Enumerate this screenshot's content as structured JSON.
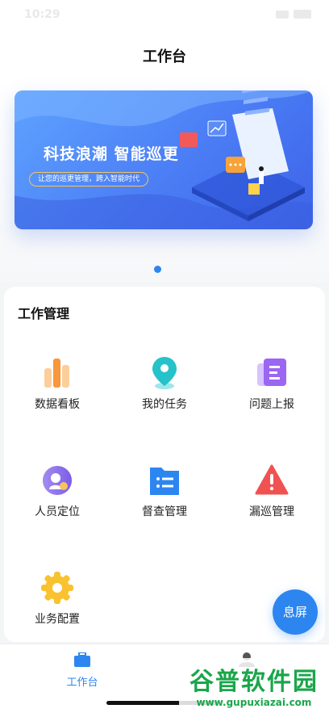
{
  "status_bar": {
    "time": "10:29"
  },
  "header": {
    "title": "工作台"
  },
  "banner": {
    "title": "科技浪潮 智能巡更",
    "subtitle": "让您的巡更管理，跨入智能时代"
  },
  "card": {
    "title": "工作管理",
    "items": [
      {
        "label": "数据看板",
        "icon": "bar-chart-icon"
      },
      {
        "label": "我的任务",
        "icon": "location-pin-icon"
      },
      {
        "label": "问题上报",
        "icon": "report-document-icon"
      },
      {
        "label": "人员定位",
        "icon": "person-location-icon"
      },
      {
        "label": "督查管理",
        "icon": "folder-list-icon"
      },
      {
        "label": "漏巡管理",
        "icon": "warning-triangle-icon"
      },
      {
        "label": "业务配置",
        "icon": "gear-icon"
      }
    ]
  },
  "float_button": {
    "label": "息屏"
  },
  "tabbar": {
    "tabs": [
      {
        "label": "工作台",
        "active": true
      },
      {
        "label": "",
        "active": false
      }
    ]
  },
  "watermark": {
    "cn": "谷普软件园",
    "en": "www.gupuxiazai.com"
  },
  "colors": {
    "accent": "#2d86f0",
    "warning": "#f05252",
    "orange": "#f7a339",
    "purple": "#8c5cf0",
    "teal": "#26c2c9",
    "green": "#1aa64a"
  }
}
